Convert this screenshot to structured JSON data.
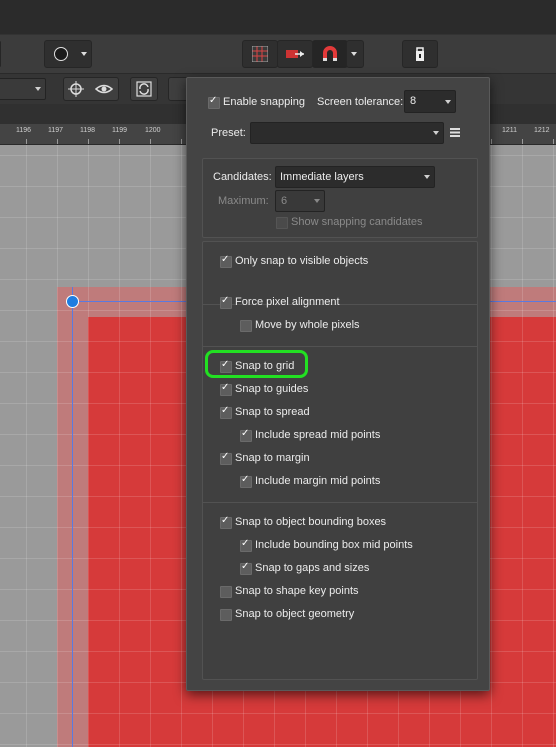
{
  "toolbar": {
    "icons": [
      "circle-tool-icon",
      "grid-icon",
      "align-icon",
      "magnet-icon",
      "lock-icon"
    ]
  },
  "contextbar": {
    "icons": [
      "crosshair-icon",
      "eye-icon",
      "refresh-icon"
    ]
  },
  "ruler": {
    "labels": [
      "1196",
      "1197",
      "1198",
      "1199",
      "1200",
      "1211",
      "1212"
    ]
  },
  "snapping": {
    "enable_label": "Enable snapping",
    "enable_checked": true,
    "tolerance_label": "Screen tolerance:",
    "tolerance_value": "8",
    "preset_label": "Preset:",
    "preset_value": "",
    "candidates_label": "Candidates:",
    "candidates_value": "Immediate layers",
    "maximum_label": "Maximum:",
    "maximum_value": "6",
    "show_candidates_label": "Show snapping candidates",
    "show_candidates_checked": false,
    "options": [
      {
        "label": "Only snap to visible objects",
        "checked": true
      },
      {
        "label": "Force pixel alignment",
        "checked": true
      },
      {
        "label": "Move by whole pixels",
        "checked": false
      },
      {
        "label": "Snap to grid",
        "checked": true
      },
      {
        "label": "Snap to guides",
        "checked": true
      },
      {
        "label": "Snap to spread",
        "checked": true
      },
      {
        "label": "Include spread mid points",
        "checked": true
      },
      {
        "label": "Snap to margin",
        "checked": true
      },
      {
        "label": "Include margin mid points",
        "checked": true
      },
      {
        "label": "Snap to object bounding boxes",
        "checked": true
      },
      {
        "label": "Include bounding box mid points",
        "checked": true
      },
      {
        "label": "Snap to gaps and sizes",
        "checked": true
      },
      {
        "label": "Snap to shape key points",
        "checked": false
      },
      {
        "label": "Snap to object geometry",
        "checked": false
      }
    ]
  },
  "colors": {
    "highlight": "#22e022",
    "artboard": "#d63a3a",
    "guide": "#5a7ae0"
  }
}
